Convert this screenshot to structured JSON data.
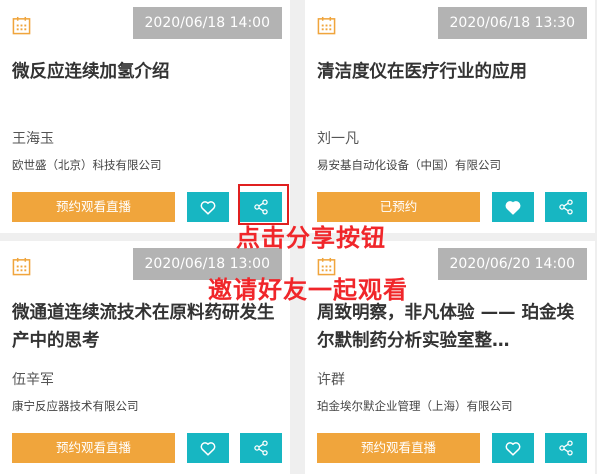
{
  "colors": {
    "primary_orange": "#f0a53c",
    "teal": "#17b6c2",
    "date_badge": "#b3b3b3",
    "annotation_red": "#f0262a"
  },
  "cards": [
    {
      "date": "2020/06/18 14:00",
      "title": "微反应连续加氢介绍",
      "speaker": "王海玉",
      "company": "欧世盛（北京）科技有限公司",
      "action_label": "预约观看直播",
      "icons": [
        "calendar-icon",
        "heart-outline-icon",
        "share-icon"
      ]
    },
    {
      "date": "2020/06/18 13:30",
      "title": "清洁度仪在医疗行业的应用",
      "speaker": "刘一凡",
      "company": "易安基自动化设备（中国）有限公司",
      "action_label": "已预约",
      "icons": [
        "calendar-icon",
        "heart-filled-icon",
        "share-icon"
      ]
    },
    {
      "date": "2020/06/18 13:00",
      "title": "微通道连续流技术在原料药研发生产中的思考",
      "speaker": "伍辛军",
      "company": "康宁反应器技术有限公司",
      "action_label": "预约观看直播",
      "icons": [
        "calendar-icon",
        "heart-outline-icon",
        "share-icon"
      ]
    },
    {
      "date": "2020/06/20 14:00",
      "title": "周致明察，非凡体验 —— 珀金埃尔默制药分析实验室整…",
      "speaker": "许群",
      "company": "珀金埃尔默企业管理（上海）有限公司",
      "action_label": "预约观看直播",
      "icons": [
        "calendar-icon",
        "heart-outline-icon",
        "share-icon"
      ]
    }
  ],
  "annotations": {
    "line1": "点击分享按钮",
    "line2": "邀请好友一起观看"
  }
}
